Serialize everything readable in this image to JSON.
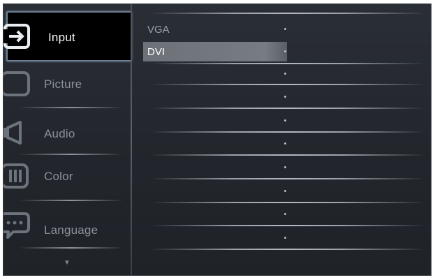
{
  "menu": {
    "items": [
      {
        "label": "Input",
        "icon": "input-icon",
        "selected": true
      },
      {
        "label": "Picture",
        "icon": "picture-icon",
        "selected": false
      },
      {
        "label": "Audio",
        "icon": "audio-icon",
        "selected": false
      },
      {
        "label": "Color",
        "icon": "color-icon",
        "selected": false
      },
      {
        "label": "Language",
        "icon": "language-icon",
        "selected": false
      }
    ],
    "scroll_arrow": "▼"
  },
  "submenu": {
    "items": [
      {
        "label": "VGA",
        "selected": false
      },
      {
        "label": "DVI",
        "selected": true
      }
    ]
  },
  "colors": {
    "panel_bg": "#23272d",
    "selected_bg": "#000000",
    "selected_border": "#6d7e92",
    "highlight": "#74797f"
  }
}
